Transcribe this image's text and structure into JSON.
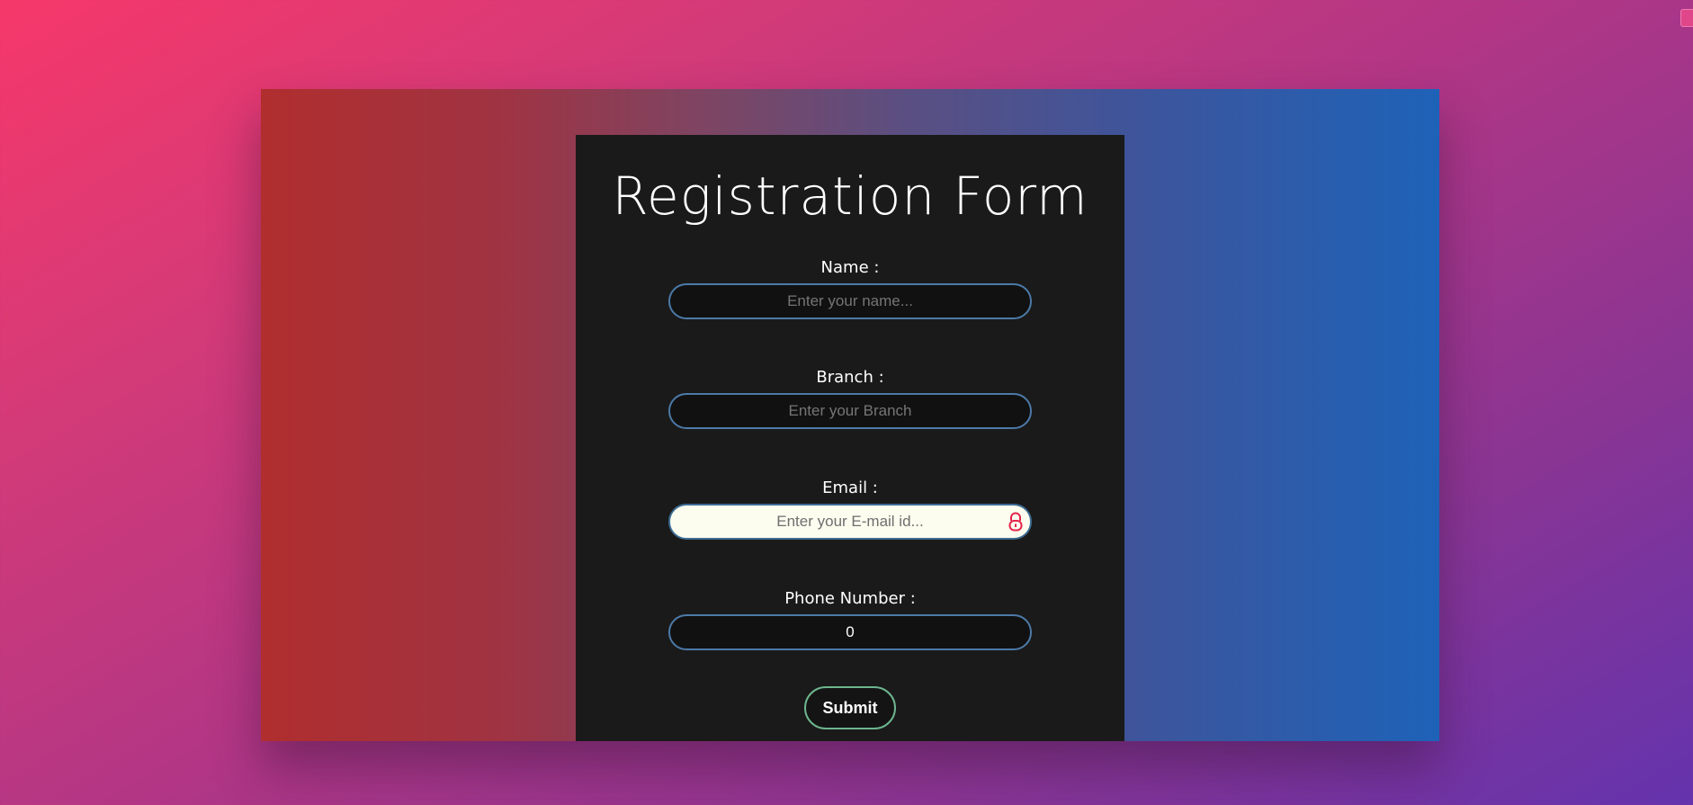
{
  "form": {
    "title": "Registration Form",
    "fields": [
      {
        "label": "Name :",
        "placeholder": "Enter your name...",
        "value": ""
      },
      {
        "label": "Branch :",
        "placeholder": "Enter your Branch",
        "value": ""
      },
      {
        "label": "Email :",
        "placeholder": "Enter your E-mail id...",
        "value": ""
      },
      {
        "label": "Phone Number :",
        "placeholder": "",
        "value": "0"
      }
    ],
    "submit_label": "Submit"
  },
  "colors": {
    "panel_background": "#1a1a1a",
    "input_border": "#4c7aa8",
    "submit_border": "#6db58e",
    "autofill_background": "#fcfdef",
    "lock_icon": "#e5234b"
  },
  "icons": {
    "email_lock": "lock-icon"
  }
}
